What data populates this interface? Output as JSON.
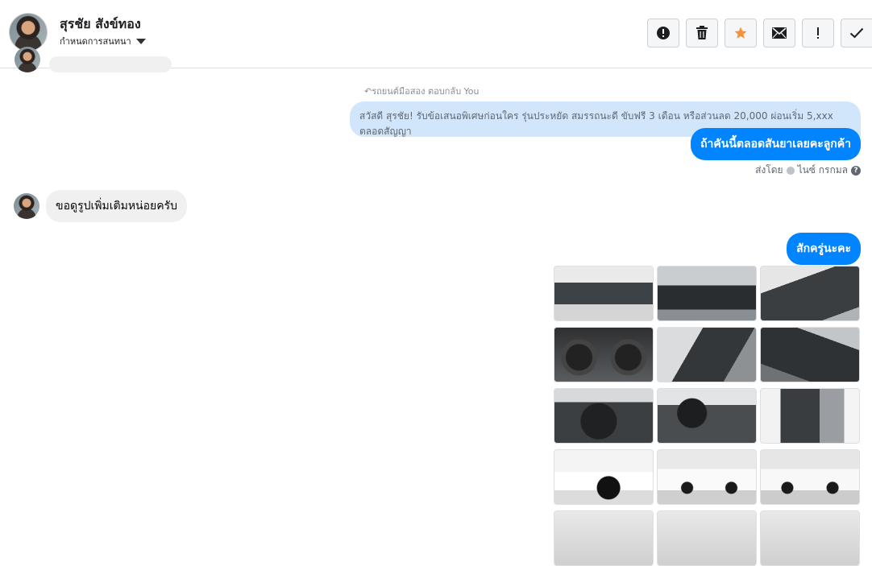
{
  "header": {
    "contact_name": "สุรชัย สังข์ทอง",
    "assign_label": "กำหนดการสนทนา",
    "toolbar": [
      {
        "name": "spam-button",
        "icon": "alert-circle-icon"
      },
      {
        "name": "delete-button",
        "icon": "trash-icon"
      },
      {
        "name": "star-button",
        "icon": "star-icon"
      },
      {
        "name": "mark-unread-button",
        "icon": "envelope-icon"
      },
      {
        "name": "follow-up-button",
        "icon": "exclamation-icon"
      },
      {
        "name": "done-button",
        "icon": "checkmark-icon"
      }
    ],
    "star_color": "#f7923b"
  },
  "conversation": {
    "reply_meta": "รถยนต์มือสอง ตอบกลับ You",
    "reply_quote": "สวัสดี สุรชัย! รับข้อเสนอพิเศษก่อนใคร รุ่นประหยัด สมรรถนะดี ขับฟรี 3 เดือน หรือส่วนลด 20,000 ผ่อนเริ่ม 5,xxx ตลอดสัญญา",
    "outgoing_1": "ถ้าคันนี้ตลอดสันยาเลยคะลูกค้า",
    "sent_by_label": "ส่งโดย",
    "sent_by_name": "ไนซ์ กรกมล",
    "incoming_1": "ขอดูรูปเพิ่มเติมหน่อยครับ",
    "outgoing_2": "สักครู่นะคะ",
    "accent_color": "#0084ff"
  },
  "photos": [
    {
      "subject": "engine-bay"
    },
    {
      "subject": "dashboard-interior"
    },
    {
      "subject": "front-seats"
    },
    {
      "subject": "gauge-cluster"
    },
    {
      "subject": "driver-seat"
    },
    {
      "subject": "gear-shifter"
    },
    {
      "subject": "steering-wheel"
    },
    {
      "subject": "steering-wheel-2"
    },
    {
      "subject": "door-panel"
    },
    {
      "subject": "front-wheel"
    },
    {
      "subject": "side-view"
    },
    {
      "subject": "side-view-2"
    },
    {
      "subject": "exterior-partial"
    },
    {
      "subject": "exterior-partial-2"
    },
    {
      "subject": "exterior-partial-3"
    }
  ]
}
